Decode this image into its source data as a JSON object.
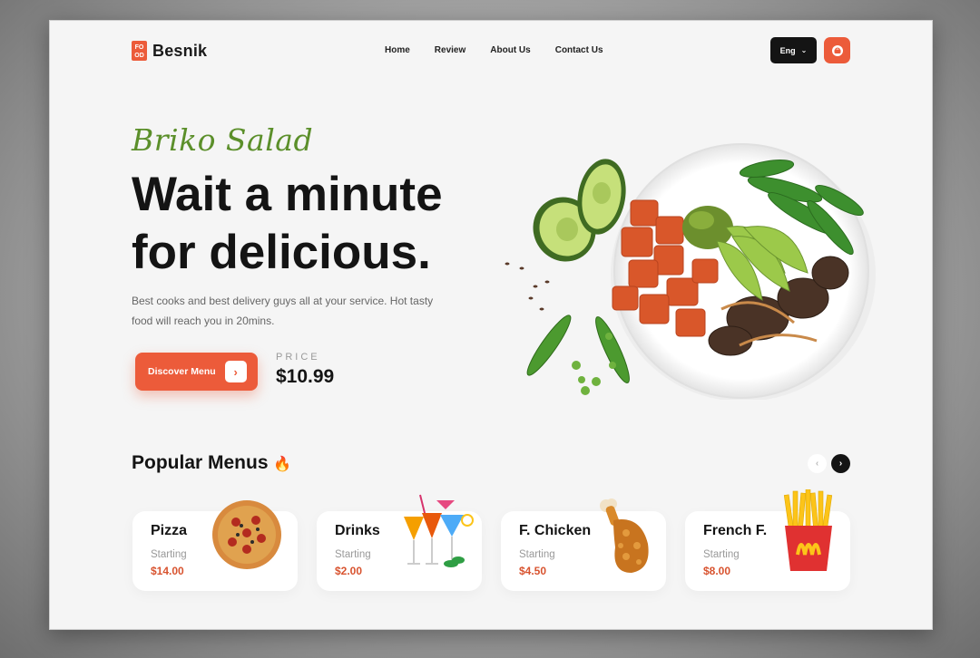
{
  "brand": {
    "logo_mark_top": "FO",
    "logo_mark_bottom": "OD",
    "name": "Besnik",
    "accent": "#ec5b3a"
  },
  "nav": {
    "items": [
      {
        "label": "Home"
      },
      {
        "label": "Review"
      },
      {
        "label": "About Us"
      },
      {
        "label": "Contact Us"
      }
    ],
    "language": "Eng",
    "cart_icon": "basket-icon"
  },
  "hero": {
    "script_title": "Briko Salad",
    "headline": "Wait a minute\nfor delicious.",
    "description": "Best cooks and best delivery guys all at your service. Hot tasty food will reach you in 20mins.",
    "cta_label": "Discover Menu",
    "price_label": "PRICE",
    "price_value": "$10.99"
  },
  "popular": {
    "title": "Popular Menus",
    "items": [
      {
        "name": "Pizza",
        "starting": "Starting",
        "price": "$14.00"
      },
      {
        "name": "Drinks",
        "starting": "Starting",
        "price": "$2.00"
      },
      {
        "name": "F. Chicken",
        "starting": "Starting",
        "price": "$4.50"
      },
      {
        "name": "French F.",
        "starting": "Starting",
        "price": "$8.00"
      }
    ]
  }
}
